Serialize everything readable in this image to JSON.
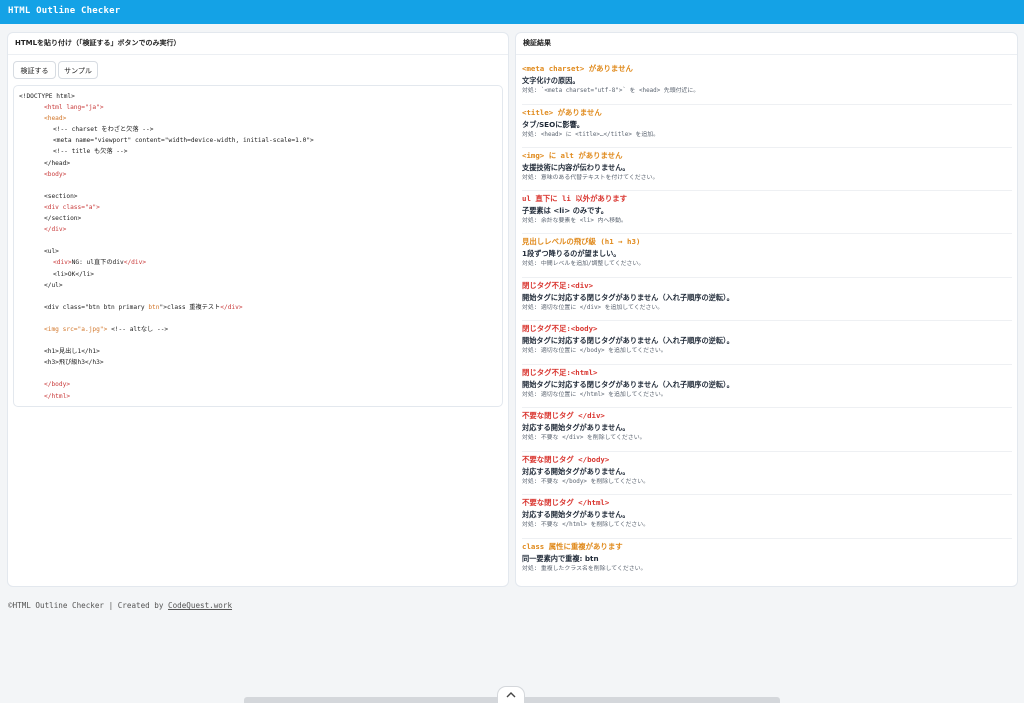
{
  "app": {
    "title": "HTML Outline Checker"
  },
  "colors": {
    "header_bg": "#14a2e6",
    "warning": "#e08a1c",
    "error": "#d9352f",
    "code_tag": "#c93a3a",
    "code_attr": "#d2762a"
  },
  "left_panel": {
    "title": "HTMLを貼り付け（「検証する」ボタンでのみ実行）",
    "buttons": {
      "verify": "検証する",
      "sample": "サンプル"
    },
    "code_lines": [
      [
        {
          "t": "<!DOCTYPE html>",
          "c": "plain"
        }
      ],
      [
        {
          "t": "<html lang=\"ja\">",
          "c": "red"
        }
      ],
      [
        {
          "t": "<head>",
          "c": "orange"
        }
      ],
      [
        {
          "t": "<!-- charset をわざと欠落 -->",
          "c": "plain"
        }
      ],
      [
        {
          "t": "<meta name=\"viewport\" content=\"width=device-width, initial-scale=1.0\">",
          "c": "plain"
        }
      ],
      [
        {
          "t": "<!-- title も欠落 -->",
          "c": "plain"
        }
      ],
      [
        {
          "t": "</head>",
          "c": "plain"
        }
      ],
      [
        {
          "t": "<body>",
          "c": "red"
        }
      ],
      [
        {
          "t": "",
          "c": "plain"
        }
      ],
      [
        {
          "t": "<section>",
          "c": "plain"
        }
      ],
      [
        {
          "t": "<div class=\"a\">",
          "c": "red"
        }
      ],
      [
        {
          "t": "</section>",
          "c": "plain"
        }
      ],
      [
        {
          "t": "</div>",
          "c": "red"
        }
      ],
      [
        {
          "t": "",
          "c": "plain"
        }
      ],
      [
        {
          "t": "<ul>",
          "c": "plain"
        }
      ],
      [
        {
          "t": "<div>",
          "c": "red"
        },
        {
          "t": "NG: ul直下のdiv",
          "c": "plain"
        },
        {
          "t": "</div>",
          "c": "red"
        }
      ],
      [
        {
          "t": "<li>OK</li>",
          "c": "plain"
        }
      ],
      [
        {
          "t": "</ul>",
          "c": "plain"
        }
      ],
      [
        {
          "t": "",
          "c": "plain"
        }
      ],
      [
        {
          "t": "<div class=\"btn btn primary ",
          "c": "plain"
        },
        {
          "t": "btn",
          "c": "orange"
        },
        {
          "t": "\">class 重複テスト",
          "c": "plain"
        },
        {
          "t": "</div>",
          "c": "red"
        }
      ],
      [
        {
          "t": "",
          "c": "plain"
        }
      ],
      [
        {
          "t": "<img src=\"a.jpg\">",
          "c": "orange"
        },
        {
          "t": " <!-- altなし -->",
          "c": "plain"
        }
      ],
      [
        {
          "t": "",
          "c": "plain"
        }
      ],
      [
        {
          "t": "<h1>見出し1</h1>",
          "c": "plain"
        }
      ],
      [
        {
          "t": "<h3>飛び級h3</h3>",
          "c": "plain"
        }
      ],
      [
        {
          "t": "",
          "c": "plain"
        }
      ],
      [
        {
          "t": "</body>",
          "c": "red"
        }
      ],
      [
        {
          "t": "</html>",
          "c": "red"
        }
      ]
    ]
  },
  "right_panel": {
    "title": "検証結果",
    "results": [
      {
        "severity": "warning",
        "title": "<meta charset> がありません",
        "desc": "文字化けの原因。",
        "fix": "対処: `<meta charset=\"utf-8\">` を <head> 先頭付近に。"
      },
      {
        "severity": "warning",
        "title": "<title> がありません",
        "desc": "タブ/SEOに影響。",
        "fix": "対処: <head> に <title>…</title> を追加。"
      },
      {
        "severity": "warning",
        "title": "<img> に alt がありません",
        "desc": "支援技術に内容が伝わりません。",
        "fix": "対処: 意味のある代替テキストを付けてください。"
      },
      {
        "severity": "error",
        "title": "ul 直下に li 以外があります",
        "desc": "子要素は <li> のみです。",
        "fix": "対処: 余計な要素を <li> 内へ移動。"
      },
      {
        "severity": "warning",
        "title": "見出しレベルの飛び級 (h1 → h3)",
        "desc": "1段ずつ降りるのが望ましい。",
        "fix": "対処: 中間レベルを追加/調整してください。"
      },
      {
        "severity": "error",
        "title": "閉じタグ不足:<div>",
        "desc": "開始タグに対応する閉じタグがありません（入れ子順序の逆転）。",
        "fix": "対処: 適切な位置に </div> を追加してください。"
      },
      {
        "severity": "error",
        "title": "閉じタグ不足:<body>",
        "desc": "開始タグに対応する閉じタグがありません（入れ子順序の逆転）。",
        "fix": "対処: 適切な位置に </body> を追加してください。"
      },
      {
        "severity": "error",
        "title": "閉じタグ不足:<html>",
        "desc": "開始タグに対応する閉じタグがありません（入れ子順序の逆転）。",
        "fix": "対処: 適切な位置に </html> を追加してください。"
      },
      {
        "severity": "error",
        "title": "不要な閉じタグ </div>",
        "desc": "対応する開始タグがありません。",
        "fix": "対処: 不要な </div> を削除してください。"
      },
      {
        "severity": "error",
        "title": "不要な閉じタグ </body>",
        "desc": "対応する開始タグがありません。",
        "fix": "対処: 不要な </body> を削除してください。"
      },
      {
        "severity": "error",
        "title": "不要な閉じタグ </html>",
        "desc": "対応する開始タグがありません。",
        "fix": "対処: 不要な </html> を削除してください。"
      },
      {
        "severity": "warning",
        "title": "class 属性に重複があります",
        "desc": "同一要素内で重複: btn",
        "fix": "対処: 重複したクラス名を削除してください。"
      }
    ]
  },
  "footer": {
    "text": "©HTML Outline Checker | Created by ",
    "link": "CodeQuest.work"
  },
  "scroll_tab": {
    "icon": "chevron-up-icon"
  }
}
